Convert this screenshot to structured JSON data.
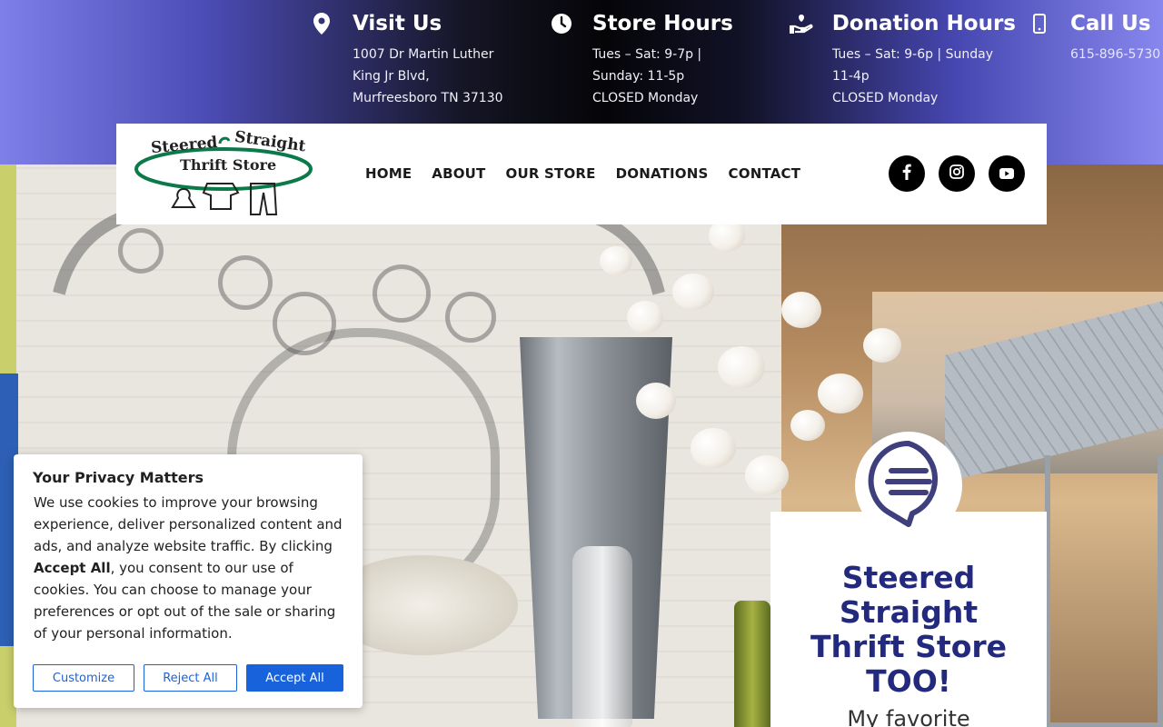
{
  "topbar": {
    "visit": {
      "icon": "map-pin-icon",
      "title": "Visit Us",
      "lines": [
        "1007 Dr Martin Luther",
        "King Jr Blvd,",
        "Murfreesboro TN 37130"
      ]
    },
    "hours": {
      "icon": "clock-icon",
      "title": "Store Hours",
      "lines": [
        "Tues – Sat: 9-7p |",
        "Sunday: 11-5p",
        "CLOSED Monday"
      ]
    },
    "donation": {
      "icon": "donation-hand-icon",
      "title": "Donation Hours",
      "lines": [
        "Tues – Sat: 9-6p | Sunday",
        "11-4p",
        "CLOSED Monday"
      ]
    },
    "call": {
      "icon": "phone-icon",
      "title": "Call Us",
      "lines": [
        "615-896-5730"
      ]
    }
  },
  "header": {
    "logo": {
      "line1": "Steered",
      "line2": "Straight",
      "line3": "Thrift Store"
    },
    "nav": [
      "HOME",
      "ABOUT",
      "OUR STORE",
      "DONATIONS",
      "CONTACT"
    ],
    "social": [
      "facebook-icon",
      "instagram-icon",
      "youtube-icon"
    ]
  },
  "promo": {
    "title": "Steered Straight Thrift Store TOO!",
    "subtitle": "My favorite"
  },
  "cookie": {
    "title": "Your Privacy Matters",
    "body_before": "We use cookies to improve your browsing experience, deliver personalized content and ads, and analyze website traffic. By clicking ",
    "body_bold": "Accept All",
    "body_after": ", you consent to our use of cookies. You can choose to manage your preferences or opt out of the sale or sharing of your personal information.",
    "customize": "Customize",
    "reject": "Reject All",
    "accept": "Accept All"
  },
  "colors": {
    "accent_blue": "#1863dc",
    "promo_navy": "#232a7e",
    "logo_green": "#0a7a4a"
  }
}
